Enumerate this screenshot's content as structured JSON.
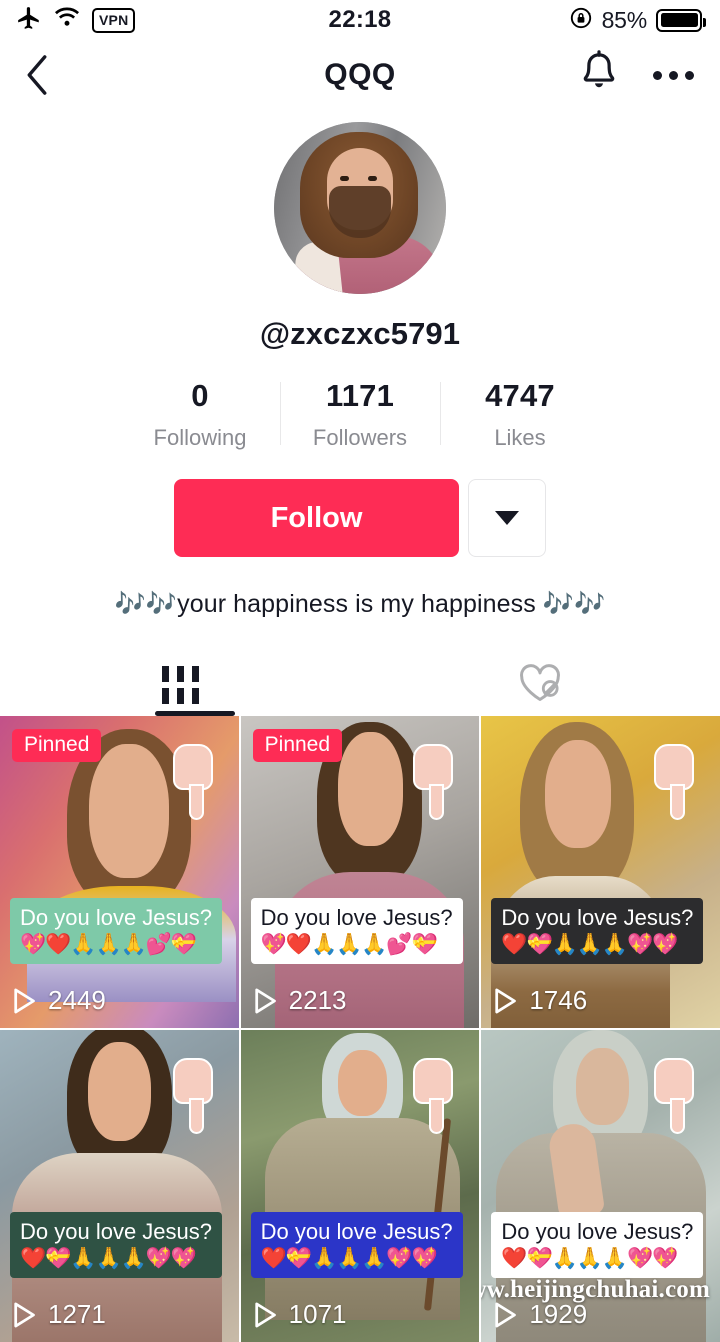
{
  "statusbar": {
    "airplane_icon": "airplane-icon",
    "wifi_icon": "wifi-icon",
    "vpn_label": "VPN",
    "time": "22:18",
    "rotation_lock_icon": "rotation-lock-icon",
    "battery_percent": "85%"
  },
  "header": {
    "back_icon": "back-chevron-icon",
    "title": "QQQ",
    "bell_icon": "bell-icon",
    "more_icon": "more-dots-icon"
  },
  "profile": {
    "avatar_name": "profile-avatar",
    "username": "@zxczxc5791",
    "stats": [
      {
        "value": "0",
        "label": "Following"
      },
      {
        "value": "1171",
        "label": "Followers"
      },
      {
        "value": "4747",
        "label": "Likes"
      }
    ],
    "follow_label": "Follow",
    "dropdown_icon": "chevron-down-icon",
    "bio": "🎶🎶your happiness is my happiness 🎶🎶",
    "accent_color": "#fe2c55"
  },
  "tabs": [
    {
      "id": "videos",
      "icon": "grid-icon",
      "active": true
    },
    {
      "id": "liked",
      "icon": "heart-slash-icon",
      "active": false
    }
  ],
  "videos": [
    {
      "pinned_label": "Pinned",
      "is_pinned": true,
      "caption": "Do you love Jesus?",
      "emojis": "💖❤️🙏🙏🙏💕💝",
      "caption_style": "green",
      "views": "2449",
      "play_icon": "play-icon",
      "hand_icon": "pointing-hand-sticker"
    },
    {
      "pinned_label": "Pinned",
      "is_pinned": true,
      "caption": "Do you love Jesus?",
      "emojis": "💖❤️🙏🙏🙏💕💝",
      "caption_style": "white",
      "views": "2213",
      "play_icon": "play-icon",
      "hand_icon": "pointing-hand-sticker"
    },
    {
      "pinned_label": "",
      "is_pinned": false,
      "caption": "Do you love Jesus?",
      "emojis": "❤️💝🙏🙏🙏💖💖",
      "caption_style": "dark",
      "views": "1746",
      "play_icon": "play-icon",
      "hand_icon": "pointing-hand-sticker"
    },
    {
      "pinned_label": "",
      "is_pinned": false,
      "caption": "Do you love Jesus?",
      "emojis": "❤️💝🙏🙏🙏💖💖",
      "caption_style": "dgreen",
      "views": "1271",
      "play_icon": "play-icon",
      "hand_icon": "pointing-hand-sticker"
    },
    {
      "pinned_label": "",
      "is_pinned": false,
      "caption": "Do you love Jesus?",
      "emojis": "❤️💝🙏🙏🙏💖💖",
      "caption_style": "blue",
      "views": "1071",
      "play_icon": "play-icon",
      "hand_icon": "pointing-hand-sticker"
    },
    {
      "pinned_label": "",
      "is_pinned": false,
      "caption": "Do you love Jesus?",
      "emojis": "❤️💝🙏🙏🙏💖💖",
      "caption_style": "white",
      "views": "1929",
      "play_icon": "play-icon",
      "hand_icon": "pointing-hand-sticker"
    }
  ],
  "watermark": "www.heijingchuhai.com"
}
